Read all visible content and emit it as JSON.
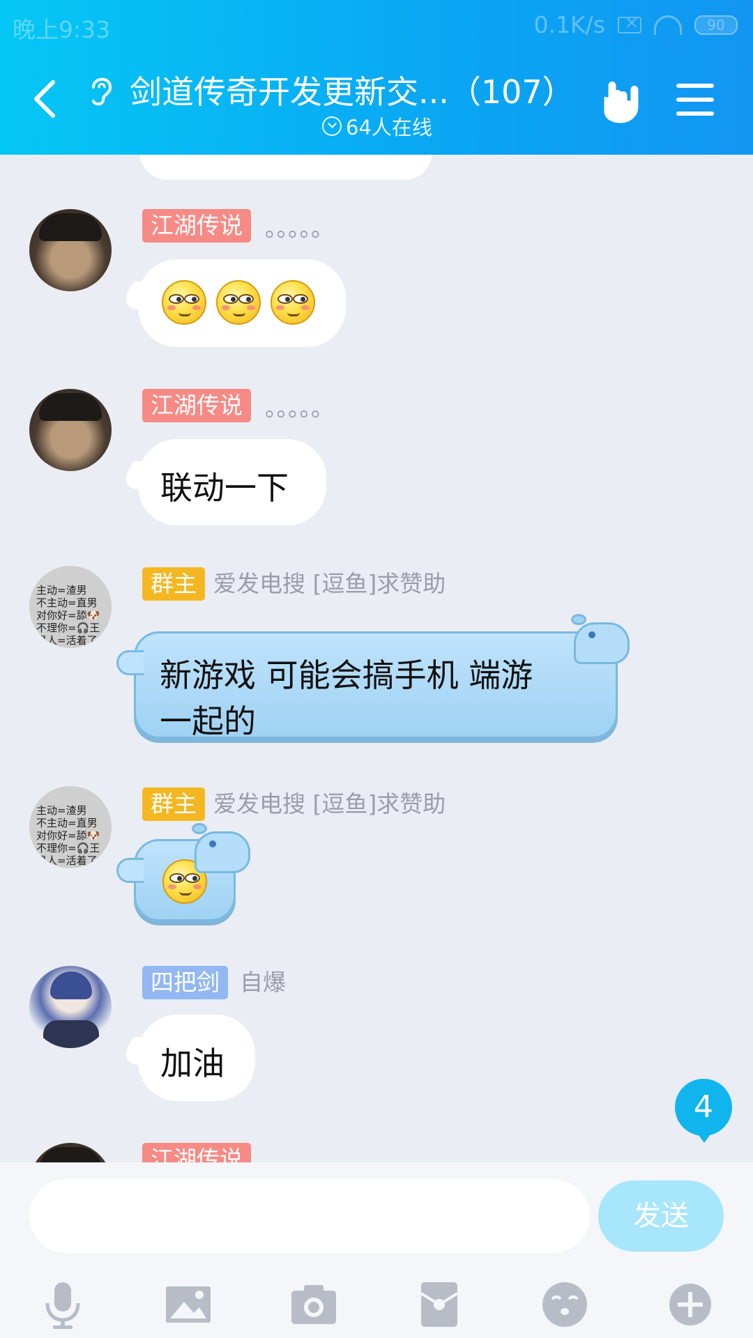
{
  "status_bar": {
    "time": "晚上9:33",
    "speed": "0.1K/s",
    "battery": "90"
  },
  "header": {
    "title": "剑道传奇开发更新交...（107）",
    "online": "64人在线",
    "icons": [
      "back-arrow-icon",
      "ear-icon",
      "hand-gesture-icon",
      "menu-icon"
    ]
  },
  "messages": [
    {
      "badge": "江湖传说",
      "badge_color": "#f68a85",
      "nick": "。。。。。",
      "type": "emoji",
      "emojis": [
        "smirk-emoji",
        "smirk-emoji",
        "smirk-emoji"
      ]
    },
    {
      "badge": "江湖传说",
      "badge_color": "#f68a85",
      "nick": "。。。。。",
      "type": "text",
      "text": "联动一下"
    },
    {
      "badge": "群主",
      "badge_color": "#f5b721",
      "nick": "爱发电搜 [逗鱼]求赞助",
      "type": "text",
      "text_line1": "新游戏 可能会搞手机 端游",
      "text_line2": "一起的",
      "avatar_text": [
        "主动=渣男",
        "不主动=直男",
        "对你好=舔🐶",
        "不理你=🎧王",
        "是人=活着了"
      ]
    },
    {
      "badge": "群主",
      "badge_color": "#f5b721",
      "nick": "爱发电搜 [逗鱼]求赞助",
      "type": "emoji",
      "emojis": [
        "smirk-emoji"
      ]
    },
    {
      "badge": "四把剑",
      "badge_color": "#92b7f2",
      "nick": "自爆",
      "type": "text",
      "text": "加油"
    },
    {
      "badge": "江湖传说",
      "badge_color": "#f68a85",
      "nick": "",
      "type": "partial"
    }
  ],
  "unread_count": "4",
  "composer": {
    "placeholder": "",
    "send_label": "发送",
    "tools": [
      "microphone-icon",
      "image-icon",
      "camera-icon",
      "red-packet-icon",
      "emoji-icon",
      "plus-icon"
    ]
  }
}
